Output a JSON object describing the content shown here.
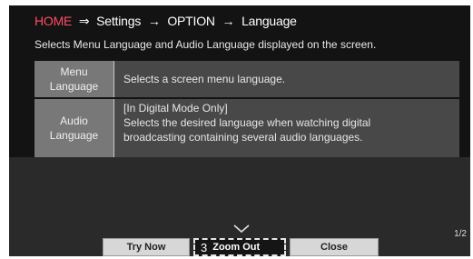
{
  "header": {
    "breadcrumb": {
      "home": "HOME",
      "arrow1": "⇒",
      "settings": "Settings",
      "arrow2": "→",
      "option": "OPTION",
      "arrow3": "→",
      "language": "Language"
    },
    "description": "Selects Menu Language and Audio Language displayed on the screen."
  },
  "table": {
    "rows": [
      {
        "label_line1": "Menu",
        "label_line2": "Language",
        "text": [
          "Selects a screen menu language."
        ]
      },
      {
        "label_line1": "Audio",
        "label_line2": "Language",
        "text": [
          "[In Digital Mode Only]",
          "Selects the desired language when watching digital",
          "broadcasting containing several audio languages."
        ]
      }
    ]
  },
  "footer": {
    "page_indicator": "1/2",
    "buttons": {
      "try_now": "Try Now",
      "zoom_number": "3",
      "zoom_out": "Zoom Out",
      "close": "Close"
    }
  },
  "colors": {
    "home_accent": "#ff4d64",
    "label_cell_bg": "#787878",
    "text_cell_bg": "#484848"
  }
}
